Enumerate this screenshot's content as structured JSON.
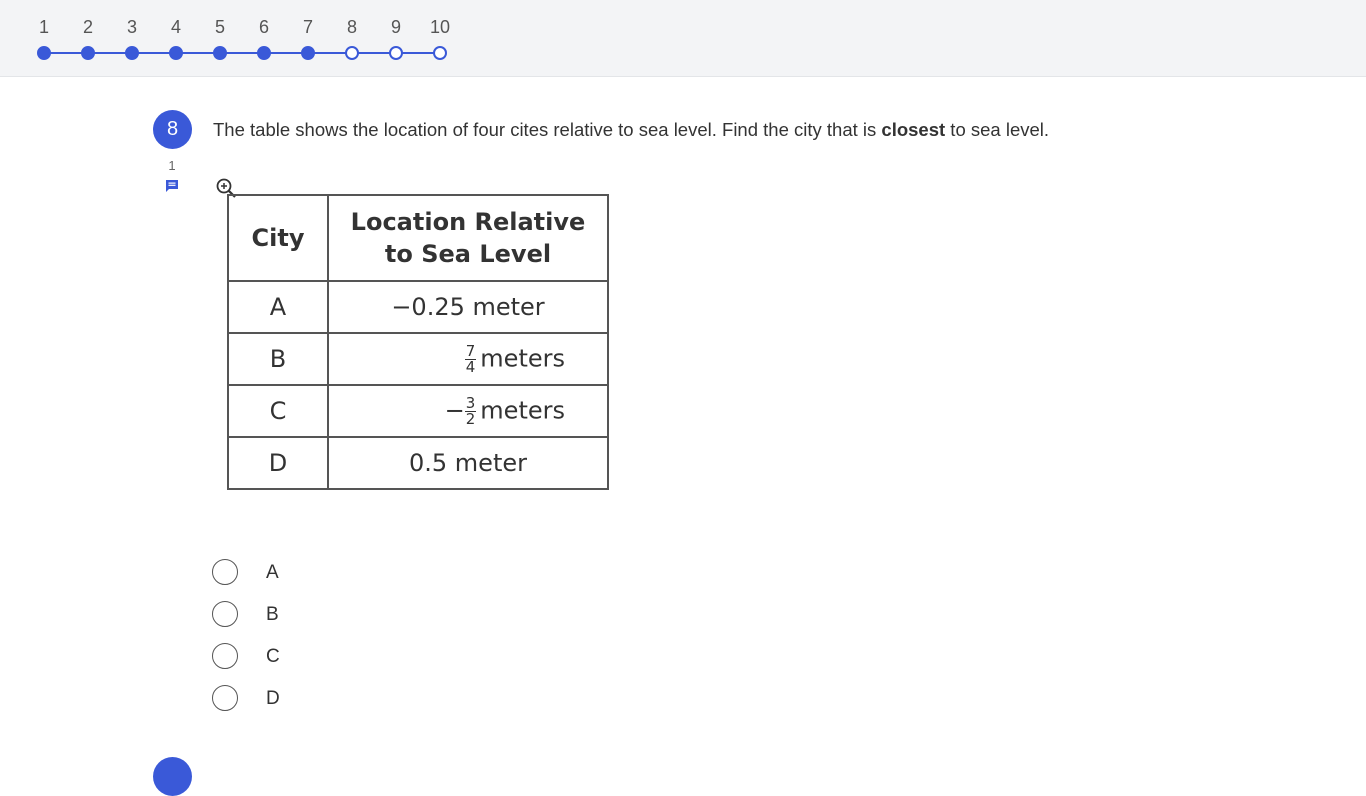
{
  "progress": {
    "steps": [
      {
        "label": "1",
        "done": true
      },
      {
        "label": "2",
        "done": true
      },
      {
        "label": "3",
        "done": true
      },
      {
        "label": "4",
        "done": true
      },
      {
        "label": "5",
        "done": true
      },
      {
        "label": "6",
        "done": true
      },
      {
        "label": "7",
        "done": true
      },
      {
        "label": "8",
        "done": false
      },
      {
        "label": "9",
        "done": false
      },
      {
        "label": "10",
        "done": false
      }
    ],
    "accent_color": "#3a59d8"
  },
  "question": {
    "number": "8",
    "comment_count": "1",
    "text_before": "The table shows the location of four cites relative to sea level. Find the city that is ",
    "text_bold": "closest",
    "text_after": " to sea level.",
    "table": {
      "headers": [
        "City",
        "Location Relative",
        "to Sea Level"
      ],
      "rows": [
        {
          "city": "A",
          "value": "−0.25 meter"
        },
        {
          "city": "B",
          "sign": "",
          "num": "7",
          "den": "4",
          "unit": "meters"
        },
        {
          "city": "C",
          "sign": "−",
          "num": "3",
          "den": "2",
          "unit": "meters"
        },
        {
          "city": "D",
          "value": "0.5 meter"
        }
      ]
    },
    "options": [
      "A",
      "B",
      "C",
      "D"
    ]
  },
  "next_question": {
    "icon": "question-number-badge"
  }
}
